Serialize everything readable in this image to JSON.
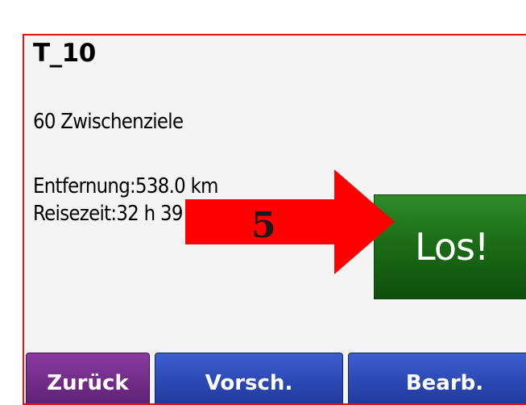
{
  "route": {
    "name": "T_10",
    "waypoints": "60 Zwischenziele",
    "distance": "Entfernung:538.0 km",
    "travel_time": "Reisezeit:32 h 39 min"
  },
  "go_button": {
    "label": "Los!",
    "color": "#1c6d17"
  },
  "annotation": {
    "number": "5",
    "color": "#ff0000"
  },
  "bottom_bar": {
    "back_label": "Zurück",
    "preview_label": "Vorsch.",
    "edit_label": "Bearb."
  },
  "colors": {
    "frame_border": "#e01414",
    "back_button": "#6b2a86",
    "blue_buttons": "#2a45b3"
  }
}
